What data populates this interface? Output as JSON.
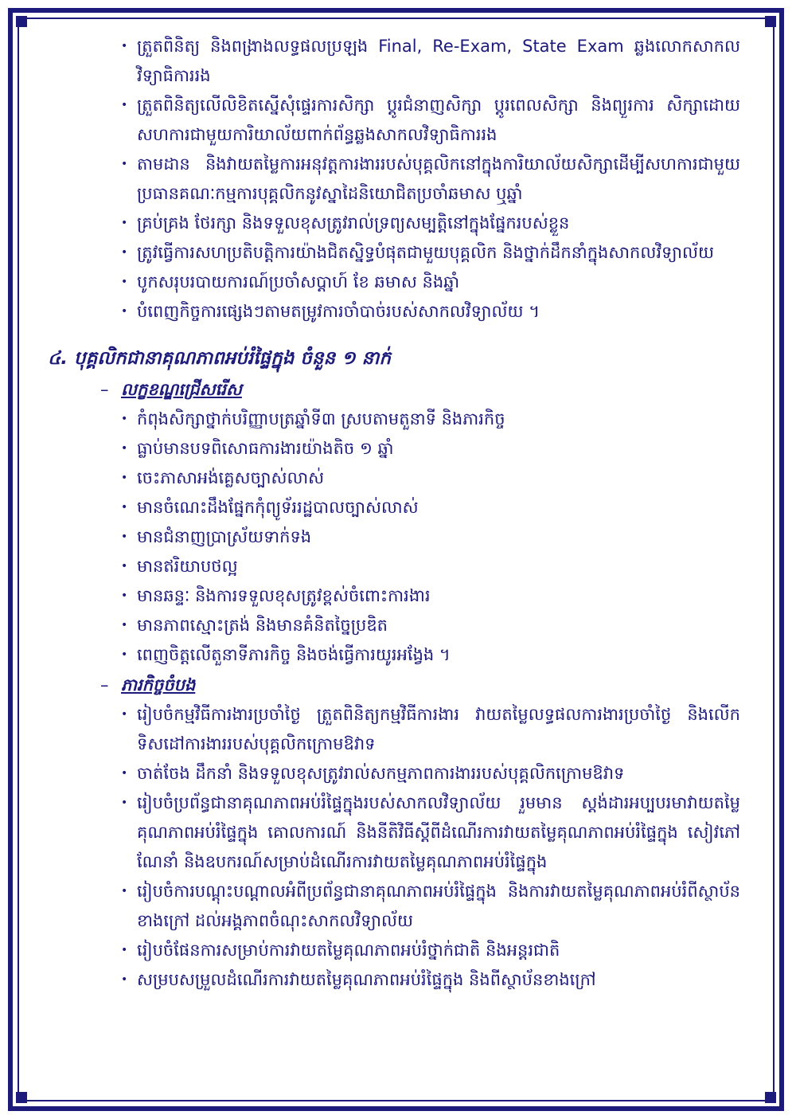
{
  "section1": {
    "items": [
      "ត្រួតពិនិត្យ និងពង្រាងលទ្ធផលប្រឡង Final, Re-Exam, State Exam ឆ្លងលោកសាកលវិទ្យាធិការរង",
      "ត្រួតពិនិត្យលើលិខិតស្នើសុំផ្ទេរការសិក្សា ប្តូរជំនាញសិក្សា ប្តូរពេលសិក្សា និងព្យួរការ សិក្សាដោយសហការជាមួយការិយាល័យពាក់ព័ន្ធឆ្លងសាកលវិទ្យាធិការរង",
      "តាមដាន និងវាយតម្លៃការអនុវត្តការងាររបស់បុគ្គលិកនៅក្នុងការិយាល័យសិក្សាដើម្បីសហការជាមួយប្រធានគណៈកម្មការបុគ្គលិកនូវស្នាដៃនិយោជិតប្រចាំឆមាស ឬឆ្នាំ",
      "គ្រប់គ្រង ថែរក្សា និងទទួលខុសត្រូវរាល់ទ្រព្យសម្បត្តិនៅក្នុងផ្នែករបស់ខ្លួន",
      "ត្រូវធ្វើការសហប្រតិបត្តិការយ៉ាងជិតស្និទ្ធបំផុតជាមួយបុគ្គលិក និងថ្នាក់ដឹកនាំក្នុងសាកលវិទ្យាល័យ",
      "បូកសរុបរបាយការណ៍ប្រចាំសប្តាហ៍ ខែ ឆមាស និងឆ្នាំ",
      "បំពេញកិច្ចការផ្សេងៗតាមតម្រូវការចាំបាច់របស់សាកលវិទ្យាល័យ ។"
    ]
  },
  "section4": {
    "heading": "៤. បុគ្គលិកជានាគុណភាពអប់រំផ្ទៃក្នុង ចំនួន ១ នាក់",
    "dash": "–",
    "bullet": "•",
    "criteria": {
      "title": "លក្ខខណ្ឌជ្រើសរើស",
      "items": [
        "កំពុងសិក្សាថ្នាក់បរិញ្ញាបត្រឆ្នាំទី៣ ស្របតាមតួនាទី និងភារកិច្ច",
        "ធ្លាប់មានបទពិសោធការងារយ៉ាងតិច ១ ឆ្នាំ",
        "ចេះភាសាអង់គ្លេសច្បាស់លាស់",
        "មានចំណេះដឹងផ្នែកកុំព្យូទ័ររដ្ឋបាលច្បាស់លាស់",
        "មានជំនាញប្រាស្រ័យទាក់ទង",
        "មានឥរិយាបថល្អ",
        "មានឆន្ទៈ និងការទទួលខុសត្រូវខ្ពស់ចំពោះការងារ",
        "មានភាពស្មោះត្រង់ និងមានគំនិតច្នៃប្រឌិត",
        "ពេញចិត្តលើតួនាទីភារកិច្ច និងចង់ធ្វើការយូរអង្វែង ។"
      ]
    },
    "duties": {
      "title": "ភារកិច្ចចំបង",
      "items": [
        "រៀបចំកម្មវិធីការងារប្រចាំថ្ងៃ ត្រួតពិនិត្យកម្មវិធីការងារ វាយតម្លៃលទ្ធផលការងារប្រចាំថ្ងៃ និងលើកទិសដៅការងាររបស់បុគ្គលិកក្រោមឱវាទ",
        "ចាត់ចែង ដឹកនាំ និងទទួលខុសត្រូវរាល់សកម្មភាពការងាររបស់បុគ្គលិកក្រោមឱវាទ",
        "រៀបចំប្រព័ន្ធជានាគុណភាពអប់រំផ្ទៃក្នុងរបស់សាកលវិទ្យាល័យ រួមមាន ស្តង់ដារអប្បបរមាវាយតម្លៃគុណភាពអប់រំផ្ទៃក្នុង គោលការណ៍ និងនីតិវិធីស្តីពីដំណើរការវាយតម្លៃគុណភាពអប់រំផ្ទៃក្នុង សៀវភៅណែនាំ និងឧបករណ៍សម្រាប់ដំណើរការវាយតម្លៃគុណភាពអប់រំផ្ទៃក្នុង",
        "រៀបចំការបណ្តុះបណ្តាលអំពីប្រព័ន្ធជានាគុណភាពអប់រំផ្ទៃក្នុង និងការវាយតម្លៃគុណភាពអប់រំពីស្ថាប័នខាងក្រៅ ដល់អង្គភាពចំណុះសាកលវិទ្យាល័យ",
        "រៀបចំផែនការសម្រាប់ការវាយតម្លៃគុណភាពអប់រំថ្នាក់ជាតិ និងអន្តរជាតិ",
        "សម្របសម្រួលដំណើរការវាយតម្លៃគុណភាពអប់រំផ្ទៃក្នុង និងពីស្ថាប័នខាងក្រៅ"
      ]
    }
  }
}
